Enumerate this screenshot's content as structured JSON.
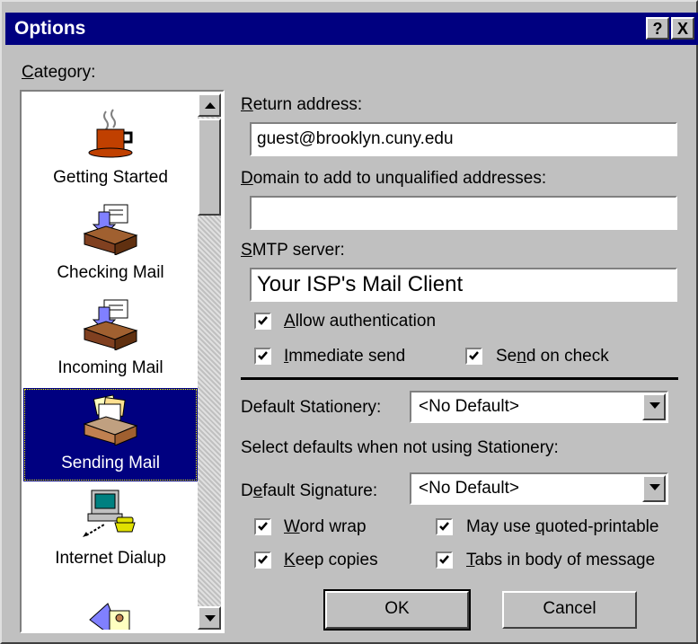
{
  "window": {
    "title": "Options",
    "help_button": "?",
    "close_button": "X"
  },
  "category": {
    "label_accel": "C",
    "label_rest": "ategory:",
    "items": [
      {
        "label": "Getting Started",
        "icon": "coffee-cup-icon"
      },
      {
        "label": "Checking Mail",
        "icon": "mailbox-tray-icon"
      },
      {
        "label": "Incoming Mail",
        "icon": "mailbox-tray-icon"
      },
      {
        "label": "Sending Mail",
        "icon": "outbox-tray-icon",
        "selected": true
      },
      {
        "label": "Internet Dialup",
        "icon": "computer-phone-icon"
      }
    ]
  },
  "return_address": {
    "label_accel": "R",
    "label_rest": "eturn address:",
    "value": "guest@brooklyn.cuny.edu"
  },
  "domain": {
    "label_accel": "D",
    "label_rest": "omain to add to unqualified addresses:",
    "value": ""
  },
  "smtp": {
    "label_accel": "S",
    "label_rest": "MTP server:",
    "value": "Your ISP's Mail Client"
  },
  "options": {
    "allow_auth": {
      "accel": "A",
      "rest": "llow authentication",
      "checked": true
    },
    "immediate_send": {
      "accel": "I",
      "rest": "mmediate send",
      "checked": true
    },
    "send_on_check": {
      "pre": "Se",
      "accel": "n",
      "rest": "d on check",
      "checked": true
    }
  },
  "stationery": {
    "label": "Default Stationery:",
    "value": "<No Default>",
    "hint": "Select defaults when not using Stationery:"
  },
  "signature": {
    "label_pre": "D",
    "label_accel": "e",
    "label_rest": "fault Signature:",
    "value": "<No Default>"
  },
  "bottom_options": {
    "word_wrap": {
      "accel": "W",
      "rest": "ord wrap",
      "checked": true
    },
    "quoted_printable": {
      "pre": "May use ",
      "accel": "q",
      "rest": "uoted-printable",
      "checked": true
    },
    "keep_copies": {
      "accel": "K",
      "rest": "eep copies",
      "checked": true
    },
    "tabs_in_body": {
      "accel": "T",
      "rest": "abs in body of message",
      "checked": true
    }
  },
  "buttons": {
    "ok": "OK",
    "cancel": "Cancel"
  },
  "colors": {
    "titlebar": "#000080",
    "face": "#c0c0c0",
    "selection": "#000080"
  }
}
